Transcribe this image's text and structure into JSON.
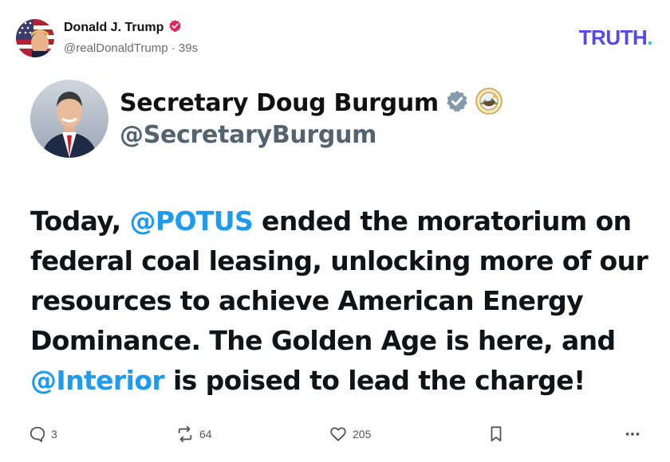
{
  "truth_post": {
    "author_name": "Donald J. Trump",
    "author_handle": "@realDonaldTrump",
    "separator": " · ",
    "time_ago": "39s",
    "brand_logo": "TRUTH",
    "brand_logo_dot": "."
  },
  "x_post": {
    "author_name": "Secretary Doug Burgum",
    "author_handle": "@SecretaryBurgum",
    "body_parts": {
      "p1": "Today, ",
      "mention1": "@POTUS",
      "p2": " ended the moratorium on federal coal leasing, unlocking more of our resources to achieve American Energy Dominance. The Golden Age is here, and ",
      "mention2": "@Interior",
      "p3": " is poised to lead the charge!"
    }
  },
  "actions": {
    "replies": "3",
    "retruths": "64",
    "likes": "205"
  },
  "colors": {
    "truth_brand": "#5448ee",
    "mention_blue": "#1d9bf0",
    "verified_red": "#e0245e",
    "gov_badge_gray": "#829aab"
  },
  "icons": [
    "verified-badge-icon",
    "gov-verified-badge-icon",
    "agency-seal-icon",
    "reply-icon",
    "retruth-icon",
    "like-icon",
    "bookmark-icon",
    "more-icon"
  ]
}
